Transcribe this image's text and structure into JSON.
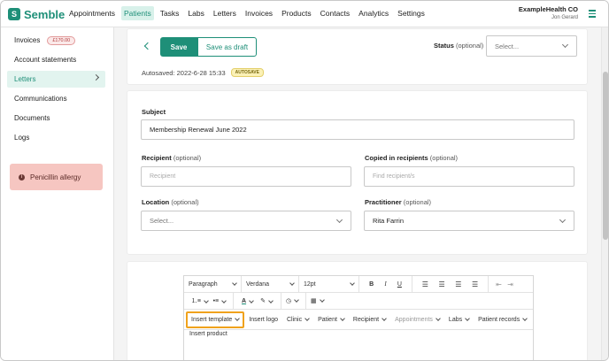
{
  "nav": {
    "logo_mark": "S",
    "logo_text": "Semble",
    "items": [
      "Appointments",
      "Patients",
      "Tasks",
      "Labs",
      "Letters",
      "Invoices",
      "Products",
      "Contacts",
      "Analytics",
      "Settings"
    ],
    "active_item": "Patients",
    "org_name": "ExampleHealth CO",
    "org_user": "Jon Gerard"
  },
  "sidebar": {
    "items": [
      {
        "label": "Invoices",
        "badge": "£170.00"
      },
      {
        "label": "Account statements"
      },
      {
        "label": "Letters",
        "active": true
      },
      {
        "label": "Communications"
      },
      {
        "label": "Documents"
      },
      {
        "label": "Logs"
      }
    ],
    "allergy_icon": "i",
    "allergy": "Penicillin allergy"
  },
  "header": {
    "save_label": "Save",
    "draft_label": "Save as draft",
    "autosaved": "Autosaved: 2022-6-28 15:33",
    "autosave_badge": "AUTOSAVE",
    "status_label": "Status",
    "status_optional": "(optional)",
    "status_value": "Select..."
  },
  "form": {
    "subject_label": "Subject",
    "subject_value": "Membership Renewal June 2022",
    "recipient_label": "Recipient",
    "recipient_optional": "(optional)",
    "recipient_placeholder": "Recipient",
    "copied_label": "Copied in recipients",
    "copied_optional": "(optional)",
    "copied_placeholder": "Find recipient/s",
    "location_label": "Location",
    "location_optional": "(optional)",
    "location_value": "Select...",
    "practitioner_label": "Practitioner",
    "practitioner_optional": "(optional)",
    "practitioner_value": "Rita Farrin"
  },
  "editor": {
    "paragraph": "Paragraph",
    "font": "Verdana",
    "size": "12pt",
    "bold": "B",
    "italic": "I",
    "underline": "U",
    "insert_template": "Insert template",
    "insert_logo": "Insert logo",
    "clinic": "Clinic",
    "patient": "Patient",
    "recipient": "Recipient",
    "appointments": "Appointments",
    "labs": "Labs",
    "patient_records": "Patient records",
    "insert_product": "Insert product"
  },
  "colors": {
    "brand": "#1e8f78",
    "allergy_bg": "#f6c6c1",
    "highlight": "#f0a21c"
  },
  "icons": [
    "menu-icon",
    "back-chevron-icon",
    "chevron-down-icon",
    "info-icon",
    "numbered-list-icon",
    "bullet-list-icon",
    "text-color-icon",
    "highlight-icon",
    "clock-icon",
    "table-icon",
    "align-left-icon",
    "align-center-icon",
    "align-right-icon",
    "align-justify-icon",
    "outdent-icon",
    "indent-icon"
  ]
}
